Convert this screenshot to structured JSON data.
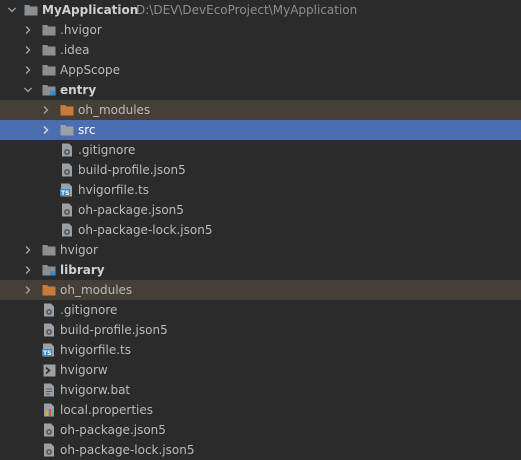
{
  "tree": [
    {
      "label": "MyApplication",
      "path": "D:\\DEV\\DevEcoProject\\MyApplication",
      "icon": "folder-icon",
      "expanded": true,
      "bold": true
    },
    {
      "label": ".hvigor",
      "icon": "folder-icon",
      "expanded": false
    },
    {
      "label": ".idea",
      "icon": "folder-icon",
      "expanded": false
    },
    {
      "label": "AppScope",
      "icon": "folder-icon",
      "expanded": false
    },
    {
      "label": "entry",
      "icon": "module-folder-icon",
      "expanded": true,
      "bold": true
    },
    {
      "label": "oh_modules",
      "icon": "excluded-folder-icon",
      "expanded": false
    },
    {
      "label": "src",
      "icon": "folder-icon",
      "expanded": false
    },
    {
      "label": ".gitignore",
      "icon": "settings-file-icon"
    },
    {
      "label": "build-profile.json5",
      "icon": "settings-file-icon"
    },
    {
      "label": "hvigorfile.ts",
      "icon": "typescript-file-icon"
    },
    {
      "label": "oh-package.json5",
      "icon": "settings-file-icon"
    },
    {
      "label": "oh-package-lock.json5",
      "icon": "settings-file-icon"
    },
    {
      "label": "hvigor",
      "icon": "folder-icon",
      "expanded": false
    },
    {
      "label": "library",
      "icon": "module-folder-icon",
      "expanded": false,
      "bold": true
    },
    {
      "label": "oh_modules",
      "icon": "excluded-folder-icon",
      "expanded": false
    },
    {
      "label": ".gitignore",
      "icon": "settings-file-icon"
    },
    {
      "label": "build-profile.json5",
      "icon": "settings-file-icon"
    },
    {
      "label": "hvigorfile.ts",
      "icon": "typescript-file-icon"
    },
    {
      "label": "hvigorw",
      "icon": "shell-script-icon"
    },
    {
      "label": "hvigorw.bat",
      "icon": "text-file-icon"
    },
    {
      "label": "local.properties",
      "icon": "properties-file-icon"
    },
    {
      "label": "oh-package.json5",
      "icon": "settings-file-icon"
    },
    {
      "label": "oh-package-lock.json5",
      "icon": "settings-file-icon"
    }
  ],
  "colors": {
    "background": "#2b2b2b",
    "selection": "#4b6eaf",
    "excluded_highlight": "#463f35",
    "excluded_text": "#d08c46",
    "folder": "#8a8f94",
    "excluded_folder": "#c87a3a",
    "ts_badge": "#3c8bc7"
  }
}
